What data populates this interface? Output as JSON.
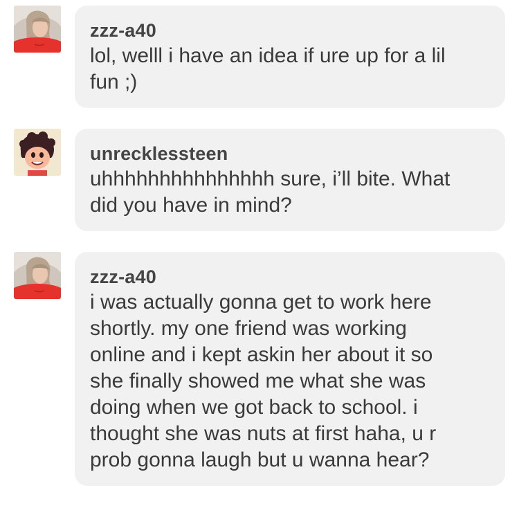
{
  "messages": [
    {
      "username": "zzz-a40",
      "avatar": "selfie-photo-avatar",
      "text": "lol, welll i have an idea if ure up for a lil\nfun ;)"
    },
    {
      "username": "unrecklessteen",
      "avatar": "cartoon-character-avatar",
      "text": "uhhhhhhhhhhhhhhh sure, i’ll bite. What\ndid you have in mind?"
    },
    {
      "username": "zzz-a40",
      "avatar": "selfie-photo-avatar",
      "text": "i was actually gonna get to work here\nshortly. my one friend was working\nonline and i kept askin her about it so\nshe finally showed me what she was\ndoing when we got back to school. i\nthought she was nuts at first haha, u r\nprob gonna laugh but u wanna hear?"
    }
  ],
  "colors": {
    "bubble": "#f1f1f1",
    "username": "#444444",
    "text": "#3a3a3a"
  }
}
